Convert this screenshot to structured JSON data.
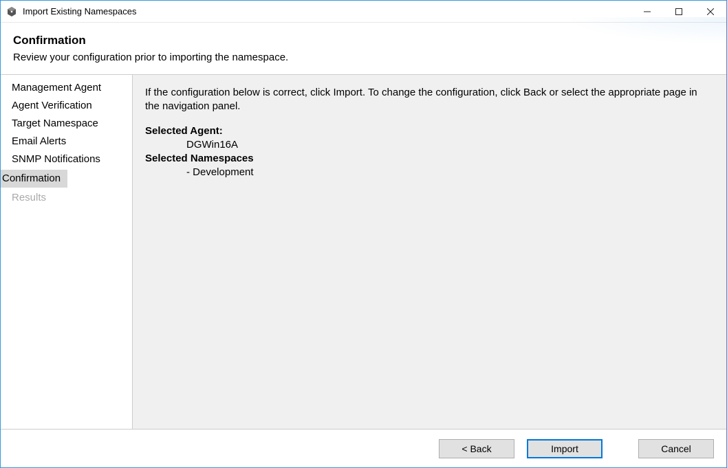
{
  "window": {
    "title": "Import Existing Namespaces"
  },
  "header": {
    "title": "Confirmation",
    "description": "Review your configuration prior to importing the namespace."
  },
  "sidebar": {
    "items": [
      {
        "label": "Management Agent",
        "state": "normal"
      },
      {
        "label": "Agent Verification",
        "state": "normal"
      },
      {
        "label": "Target Namespace",
        "state": "normal"
      },
      {
        "label": "Email Alerts",
        "state": "normal"
      },
      {
        "label": "SNMP Notifications",
        "state": "normal"
      },
      {
        "label": "Confirmation",
        "state": "selected"
      },
      {
        "label": "Results",
        "state": "disabled"
      }
    ]
  },
  "content": {
    "instruction": "If the configuration below is correct, click Import. To change the configuration, click Back or select the appropriate page in the navigation panel.",
    "selected_agent_label": "Selected Agent:",
    "selected_agent_value": "DGWin16A",
    "selected_namespaces_label": "Selected Namespaces",
    "namespaces": [
      "- Development"
    ]
  },
  "footer": {
    "back_label": "< Back",
    "import_label": "Import",
    "cancel_label": "Cancel"
  }
}
